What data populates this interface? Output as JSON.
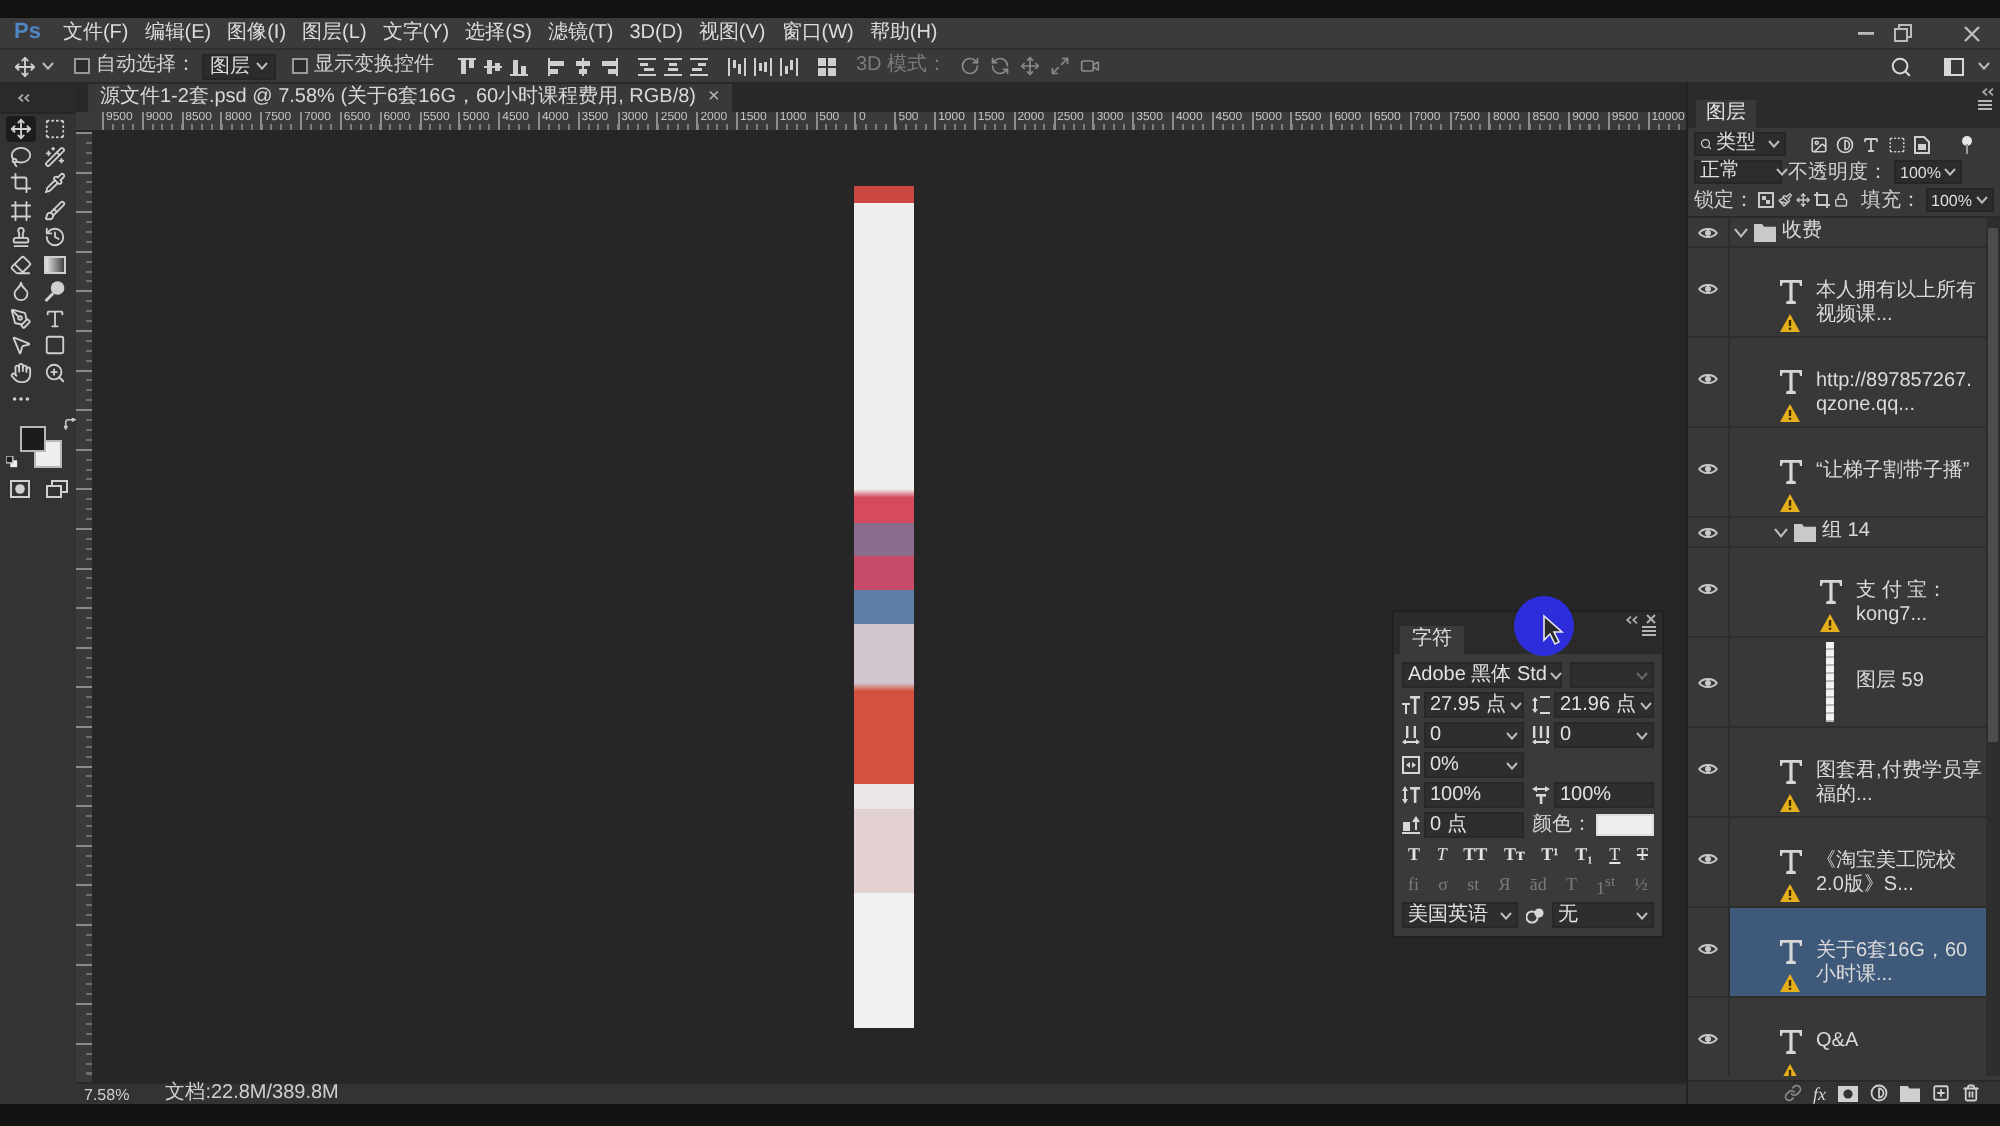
{
  "app": {
    "logo": "Ps"
  },
  "menu_bar": {
    "items": [
      "文件(F)",
      "编辑(E)",
      "图像(I)",
      "图层(L)",
      "文字(Y)",
      "选择(S)",
      "滤镜(T)",
      "3D(D)",
      "视图(V)",
      "窗口(W)",
      "帮助(H)"
    ]
  },
  "options_bar": {
    "auto_select": {
      "label": "自动选择：",
      "checked": false
    },
    "target": {
      "value": "图层"
    },
    "show_transform": {
      "label": "显示变换控件",
      "checked": false
    },
    "mode_3d_label": "3D 模式："
  },
  "toolbar": {
    "tools": [
      {
        "selected": true
      },
      {
        "selected": false
      },
      {
        "selected": false
      },
      {
        "selected": false
      },
      {
        "selected": false
      },
      {
        "selected": false
      },
      {
        "selected": false
      },
      {
        "selected": false
      },
      {
        "selected": false
      },
      {
        "selected": false
      },
      {
        "selected": false
      },
      {
        "selected": false
      },
      {
        "selected": false
      },
      {
        "selected": false
      },
      {
        "selected": false
      },
      {
        "selected": false
      },
      {
        "selected": false
      },
      {
        "selected": false
      },
      {
        "selected": false
      },
      {
        "selected": false
      },
      {
        "selected": false
      }
    ],
    "swatches": [
      {
        "kind": "foreground",
        "color": "#1c1c1c"
      },
      {
        "kind": "background",
        "color": "#efefef"
      }
    ]
  },
  "document_tab": {
    "title": "源文件1-2套.psd @ 7.58% (关于6套16G，60小时课程费用, RGB/8)",
    "close": "×"
  },
  "ruler": {
    "labels": [
      "9500",
      "9000",
      "8500",
      "8000",
      "7500",
      "7000",
      "6500",
      "6000",
      "5500",
      "5000",
      "4500",
      "4000",
      "3500",
      "3000",
      "2500",
      "2000",
      "1500",
      "1000",
      "500",
      "0",
      "500",
      "1000",
      "1500",
      "2000",
      "2500",
      "3000",
      "3500",
      "4000",
      "4500",
      "5000",
      "5500",
      "6000",
      "6500",
      "7000",
      "7500",
      "8000",
      "8500",
      "9000",
      "9500",
      "10000"
    ]
  },
  "character_panel": {
    "tab": "字符",
    "font_family": "Adobe 黑体 Std",
    "font_size": "27.95 点",
    "leading": "21.96 点",
    "kerning": "0",
    "tracking": "0",
    "tsume": "0%",
    "vertical_scale": "100%",
    "horizontal_scale": "100%",
    "baseline_shift": "0 点",
    "color_label": "颜色：",
    "color": "#efefef",
    "style_buttons": [
      {
        "label": "T",
        "kind": "bold"
      },
      {
        "label": "T",
        "kind": "italic"
      },
      {
        "label": "TT",
        "kind": "caps"
      },
      {
        "label": "Tᴛ",
        "kind": "small_caps"
      },
      {
        "label": "T¹",
        "kind": "superscript"
      },
      {
        "label": "T₁",
        "kind": "subscript"
      },
      {
        "label": "T",
        "kind": "underline"
      },
      {
        "label": "T",
        "kind": "strikethrough"
      }
    ],
    "opentype_buttons": [
      {
        "label": "fi",
        "disabled": true
      },
      {
        "label": "σ",
        "disabled": true
      },
      {
        "label": "st",
        "disabled": true
      },
      {
        "label": "Я",
        "disabled": true
      },
      {
        "label": "ād",
        "disabled": true
      },
      {
        "label": "T",
        "disabled": true
      },
      {
        "label": "1$^{st}$",
        "disabled": true
      },
      {
        "label": "½",
        "disabled": true
      }
    ],
    "language": "美国英语",
    "antialias": "无"
  },
  "layers_panel": {
    "tab": "图层",
    "filter": "类型",
    "blend_mode": "正常",
    "opacity_label": "不透明度：",
    "opacity": "100%",
    "lock_label": "锁定：",
    "fill_label": "填充：",
    "fill": "100%",
    "layers": [
      {
        "kind": "group",
        "name": "收费",
        "visible": true,
        "expanded": true,
        "selected": false,
        "children": [
          {
            "kind": "text",
            "name": "本人拥有以上所有视频课...",
            "visible": true,
            "warning": true,
            "selected": false
          },
          {
            "kind": "text",
            "name": "http://897857267.qzone.qq...",
            "visible": true,
            "warning": true,
            "selected": false
          },
          {
            "kind": "text",
            "name": "“让梯子割带子播”",
            "visible": true,
            "warning": true,
            "selected": false
          },
          {
            "kind": "group",
            "name": "组 14",
            "visible": true,
            "expanded": true,
            "selected": false,
            "children": [
              {
                "kind": "text",
                "name": "支 付 宝：kong7...",
                "visible": true,
                "warning": true,
                "selected": false
              },
              {
                "kind": "image",
                "name": "图层 59",
                "visible": true,
                "warning": false,
                "selected": false
              }
            ]
          },
          {
            "kind": "text",
            "name": "图套君,付费学员享福的...",
            "visible": true,
            "warning": true,
            "selected": false
          },
          {
            "kind": "text",
            "name": "《淘宝美工院校2.0版》S...",
            "visible": true,
            "warning": true,
            "selected": false
          },
          {
            "kind": "text",
            "name": "关于6套16G，60小时课...",
            "visible": true,
            "warning": true,
            "selected": true
          },
          {
            "kind": "text",
            "name": "Q&A",
            "visible": true,
            "warning": true,
            "selected": false
          }
        ]
      }
    ],
    "effects_label": "fx"
  },
  "status_bar": {
    "zoom": "7.58%",
    "doc_size": "文档:22.8M/389.8M"
  }
}
